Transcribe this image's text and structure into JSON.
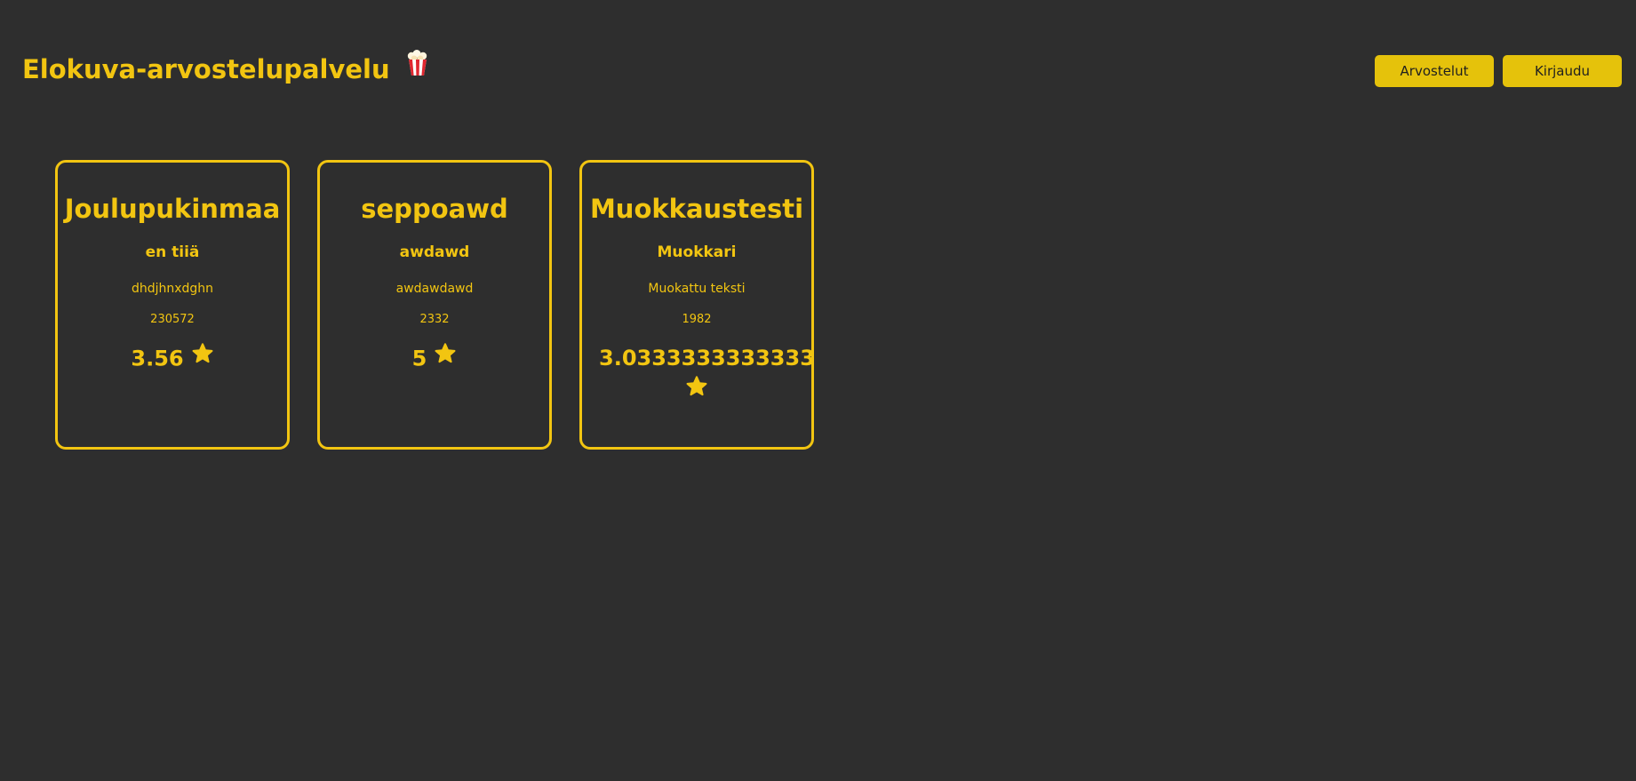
{
  "header": {
    "title": "Elokuva-arvostelupalvelu",
    "title_icon": "popcorn-icon",
    "nav": {
      "reviews_label": "Arvostelut",
      "login_label": "Kirjaudu"
    }
  },
  "colors": {
    "background": "#2e2e2e",
    "accent": "#f2c511",
    "button": "#e5c20b",
    "button_text": "#1f1f1f"
  },
  "cards": [
    {
      "title": "Joulupukinmaa",
      "subtitle": "en tiiä",
      "text": "dhdjhnxdghn",
      "year": "230572",
      "rating": "3.56",
      "rating_icon": "star-icon"
    },
    {
      "title": "seppoawd",
      "subtitle": "awdawd",
      "text": "awdawdawd",
      "year": "2332",
      "rating": "5",
      "rating_icon": "star-icon"
    },
    {
      "title": "Muokkaustesti",
      "subtitle": "Muokkari",
      "text": "Muokattu teksti",
      "year": "1982",
      "rating": "3.0333333333333",
      "rating_icon": "star-icon"
    }
  ]
}
